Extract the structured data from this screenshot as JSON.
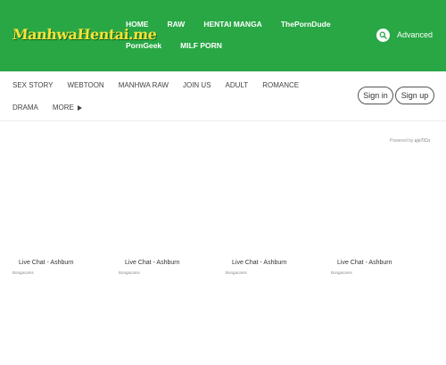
{
  "site": {
    "logo_text": "ManhwaHentai.me"
  },
  "main_nav": {
    "items": [
      {
        "label": "HOME"
      },
      {
        "label": "RAW"
      },
      {
        "label": "HENTAI MANGA"
      },
      {
        "label": "ThePornDude"
      },
      {
        "label": "PornGeek"
      },
      {
        "label": "MILF PORN"
      }
    ]
  },
  "search": {
    "icon": "search-icon",
    "advanced_label": "Advanced"
  },
  "sub_nav": {
    "items": [
      {
        "label": "SEX STORY"
      },
      {
        "label": "WEBTOON"
      },
      {
        "label": "MANHWA RAW"
      },
      {
        "label": "JOIN US"
      },
      {
        "label": "ADULT"
      },
      {
        "label": "ROMANCE"
      },
      {
        "label": "DRAMA"
      },
      {
        "label": "MORE"
      }
    ]
  },
  "auth": {
    "signin_label": "Sign in",
    "signup_label": "Sign up"
  },
  "ads": {
    "powered_prefix": "Powered by",
    "powered_brand": "ejoTiCo",
    "items": [
      {
        "title": "Live Chat - Ashburn",
        "source": "Bongacams"
      },
      {
        "title": "Live Chat - Ashburn",
        "source": "Bongacams"
      },
      {
        "title": "Live Chat - Ashburn",
        "source": "Bongacams"
      },
      {
        "title": "Live Chat - Ashburn",
        "source": "Bongacams"
      }
    ]
  },
  "colors": {
    "header_bg": "#28a744",
    "logo": "#f6e23a"
  }
}
